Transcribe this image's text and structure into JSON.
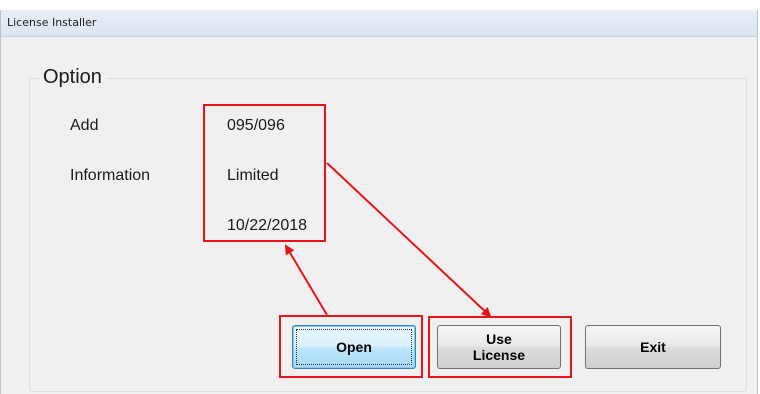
{
  "window": {
    "title": "License Installer"
  },
  "group": {
    "title": "Option"
  },
  "fields": {
    "add_label": "Add",
    "info_label": "Information",
    "add_value": "095/096",
    "info_value": "Limited",
    "date_value": "10/22/2018"
  },
  "buttons": {
    "open_label": "Open",
    "use_license_line1": "Use",
    "use_license_line2": "License",
    "exit_label": "Exit"
  },
  "colors": {
    "annotation": "#e8141c",
    "window_bg": "#f0f0f0",
    "focus_border": "#3c7fb1"
  }
}
